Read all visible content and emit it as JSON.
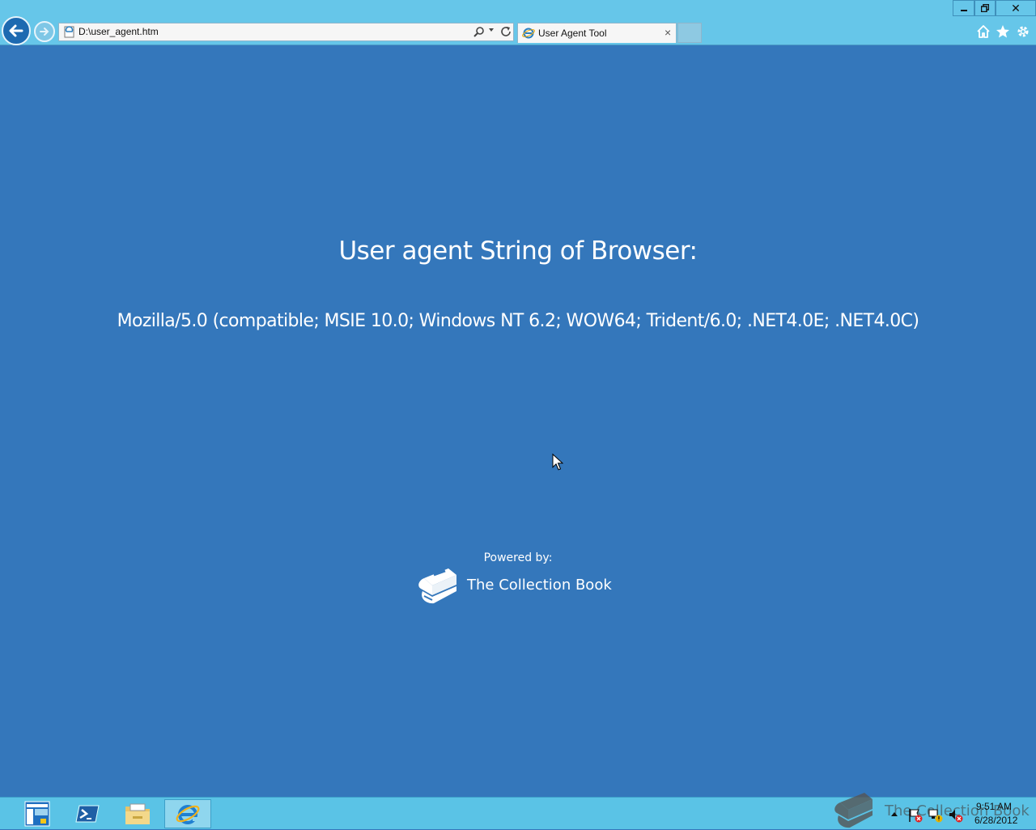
{
  "browser": {
    "address": "D:\\user_agent.htm",
    "tab_title": "User Agent Tool",
    "tab_close": "×",
    "window_close": "✕"
  },
  "page": {
    "heading": "User agent String of Browser:",
    "user_agent": "Mozilla/5.0 (compatible; MSIE 10.0; Windows NT 6.2; WOW64; Trident/6.0; .NET4.0E; .NET4.0C)",
    "powered_label": "Powered by:",
    "brand_name": "The Collection Book"
  },
  "taskbar": {
    "watermark": "The Collection Book",
    "time": "9:51 AM",
    "date": "6/28/2012"
  },
  "colors": {
    "page_background": "#3477bb",
    "chrome": "#66c6e9",
    "taskbar": "#5ac3e6"
  }
}
